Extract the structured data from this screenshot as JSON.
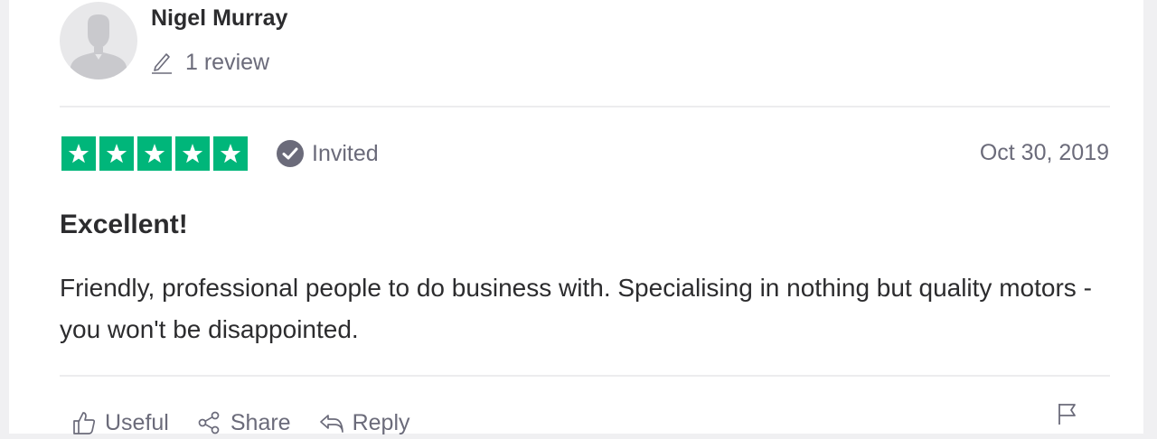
{
  "reviewer": {
    "name": "Nigel Murray",
    "review_count": "1 review",
    "avatar_icon": "default-user-avatar"
  },
  "rating": {
    "stars": 5,
    "max_stars": 5,
    "star_color": "#00b67a"
  },
  "verification": {
    "label": "Invited",
    "icon": "check-circle-icon"
  },
  "date": "Oct 30, 2019",
  "review": {
    "title": "Excellent!",
    "body": "Friendly, professional people to do business with. Specialising in nothing but quality motors - you won't be disappointed."
  },
  "actions": {
    "useful_label": "Useful",
    "share_label": "Share",
    "reply_label": "Reply"
  },
  "colors": {
    "text_primary": "#2c2c2e",
    "text_secondary": "#6b6b7a",
    "divider": "#ececee"
  }
}
